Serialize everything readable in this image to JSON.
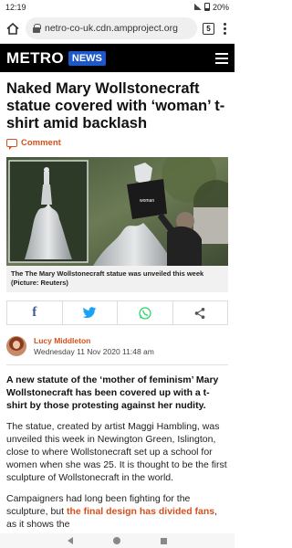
{
  "status_bar": {
    "time": "12:19",
    "battery": "20%"
  },
  "browser": {
    "url": "netro-co-uk.cdn.ampproject.org",
    "tab_count": "5"
  },
  "site": {
    "logo": "METRO",
    "section": "NEWS"
  },
  "article": {
    "headline": "Naked Mary Wollstonecraft statue covered with ‘woman’ t-shirt amid backlash",
    "comment_label": "Comment",
    "image_caption": "The The Mary Wollstonecraft statue was unveiled this week (Picture: Reuters)",
    "author": "Lucy Middleton",
    "date": "Wednesday 11 Nov 2020 11:48 am",
    "lead": "A new statute of the ‘mother of feminism’ Mary Wollstonecraft has been covered up with a t-shirt by those protesting against her nudity.",
    "paragraph1": "The statue, created by artist Maggi Hambling, was unveiled this week in Newington Green, Islington, close to where Wollstonecraft set up a school for women when she was 25. It is thought to be the first sculpture of Wollstonecraft in the world.",
    "paragraph2_start": "Campaigners had long been fighting for the sculpture, but ",
    "paragraph2_link": "the final design has divided fans",
    "paragraph2_end": ", as it shows the"
  },
  "share": {
    "facebook_icon": "facebook-icon",
    "twitter_icon": "twitter-icon",
    "whatsapp_icon": "whatsapp-icon",
    "share_icon": "share-icon"
  },
  "colors": {
    "accent": "#d64f1c",
    "news_badge": "#1e57c9",
    "facebook": "#3b5998",
    "twitter": "#1da1f2",
    "whatsapp": "#25d366"
  }
}
